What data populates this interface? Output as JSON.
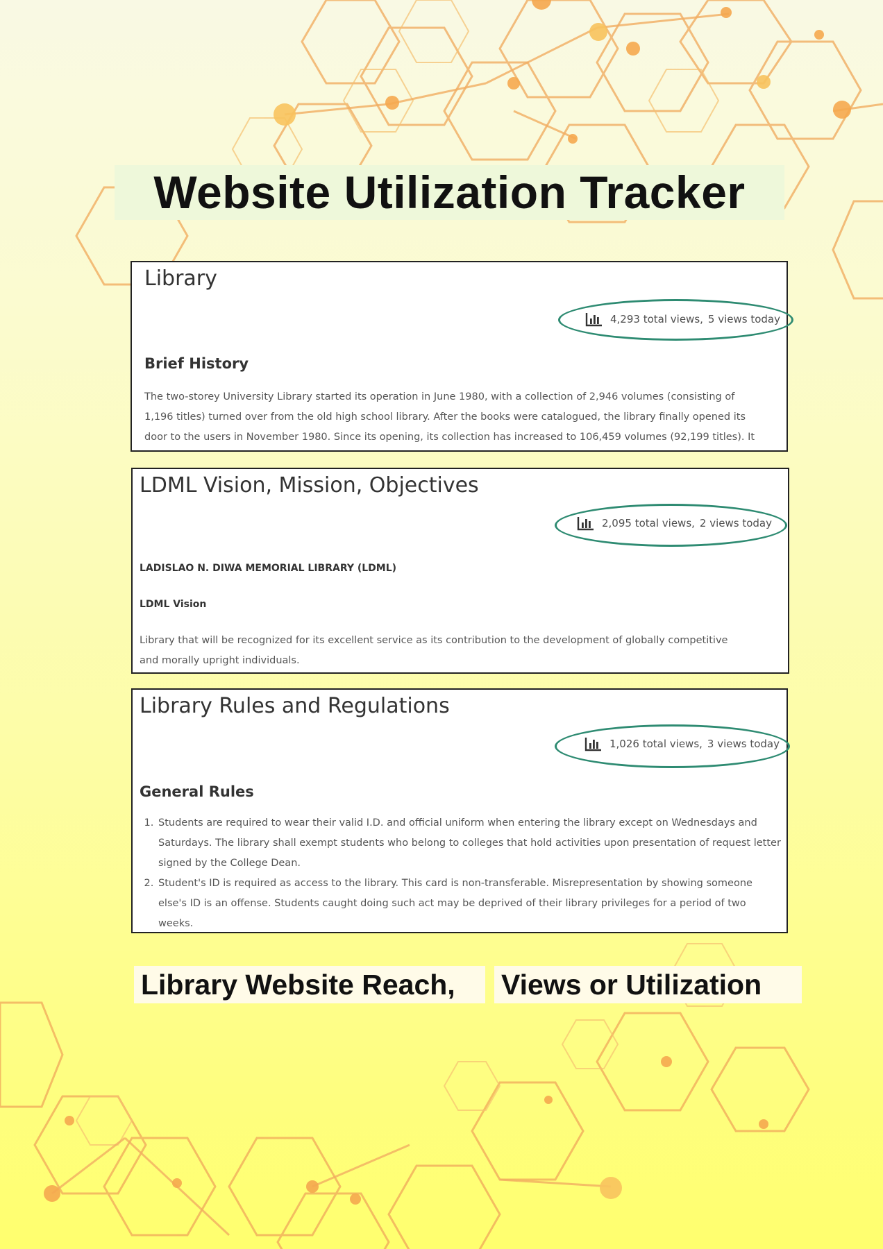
{
  "poster": {
    "title": "Website Utilization Tracker",
    "bottom_label_left": "Library Website Reach,",
    "bottom_label_right": "Views or Utilization"
  },
  "panels": [
    {
      "title": "Library",
      "views_total": "4,293 total views,",
      "views_today": "5 views today",
      "heading": "Brief History",
      "body_lines": [
        "The two-storey University Library started its operation in June 1980, with a collection of 2,946 volumes (consisting of",
        "1,196 titles) turned over from the old high school library. After the books were catalogued,  the library finally opened its",
        "door to the users in November 1980. Since its opening, its collection has increased to 106,459 volumes (92,199 titles). It"
      ]
    },
    {
      "title": "LDML Vision, Mission, Objectives",
      "views_total": "2,095 total views,",
      "views_today": "2 views today",
      "library_name": "LADISLAO N. DIWA MEMORIAL LIBRARY (LDML)",
      "vision_heading": "LDML Vision",
      "body_lines": [
        "Library that will be recognized for its excellent service as its contribution to the development of globally competitive",
        "and morally upright individuals."
      ]
    },
    {
      "title": "Library Rules and Regulations",
      "views_total": "1,026 total views,",
      "views_today": "3 views today",
      "heading": "General Rules",
      "rules": [
        "Students are required to wear their valid I.D. and official uniform when entering the library except on Wednesdays and Saturdays. The library shall exempt students who belong to colleges that hold activities upon presentation of request letter signed by the College Dean.",
        "Student's ID is required as access to the library. This card is non-transferable. Misrepresentation by showing someone else's ID is an offense. Students caught doing such act may be deprived of their library privileges for a period of two weeks."
      ]
    }
  ],
  "icons": {
    "views": "bar-chart-icon"
  },
  "colors": {
    "oval": "#2e8b72",
    "hexagon_orange": "#f0a050",
    "title_bg": "#eef8da"
  }
}
